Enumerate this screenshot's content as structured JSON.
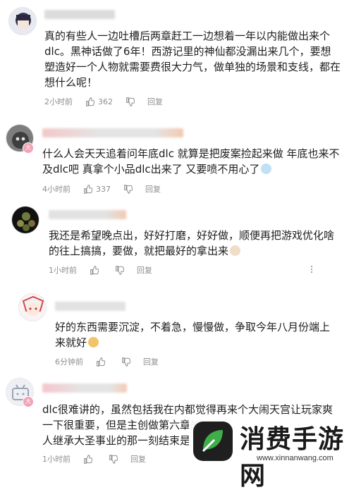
{
  "comments": [
    {
      "text": "真的有些人一边吐槽后两章赶工一边想着一年以内能做出来个dlc。黑神话做了6年！西游记里的神仙都没漏出来几个，要想塑造好一个人物就需要费很大力气，做单独的场景和支线，都在想什么呢！",
      "time": "2小时前",
      "likes": "362",
      "reply": "回复"
    },
    {
      "text": "什么人会天天追着问年底dlc 就算是把废案捡起来做 年底也来不及dlc吧 真拿个小品dlc出来了 又要喷不用心了",
      "time": "4小时前",
      "likes": "337",
      "reply": "回复"
    },
    {
      "text": "我还是希望晚点出，好好打磨，好好做，顺便再把游戏优化啥的往上搞搞，要做，就把最好的拿出来",
      "time": "1小时前",
      "reply": "回复"
    },
    {
      "text": "好的东西需要沉淀，不着急，慢慢做，争取今年八月份端上来就好",
      "time": "6分钟前",
      "reply": "回复"
    },
    {
      "text": "dlc很难讲的，虽然包括我在内都觉得再来个大闹天宫让玩家爽一下很重要，但是主创做第六章的",
      "text_2": "人继承大圣事业的那一刻结束是",
      "time": "1小时前",
      "reply": "回复"
    }
  ],
  "watermark": {
    "title": "消费手游网",
    "url": "www.xinnanwang.com"
  },
  "colors": {
    "name_blur": "#e3e3e3",
    "name_accent": "#f5b79a",
    "meta_text": "#8e8e8e"
  }
}
